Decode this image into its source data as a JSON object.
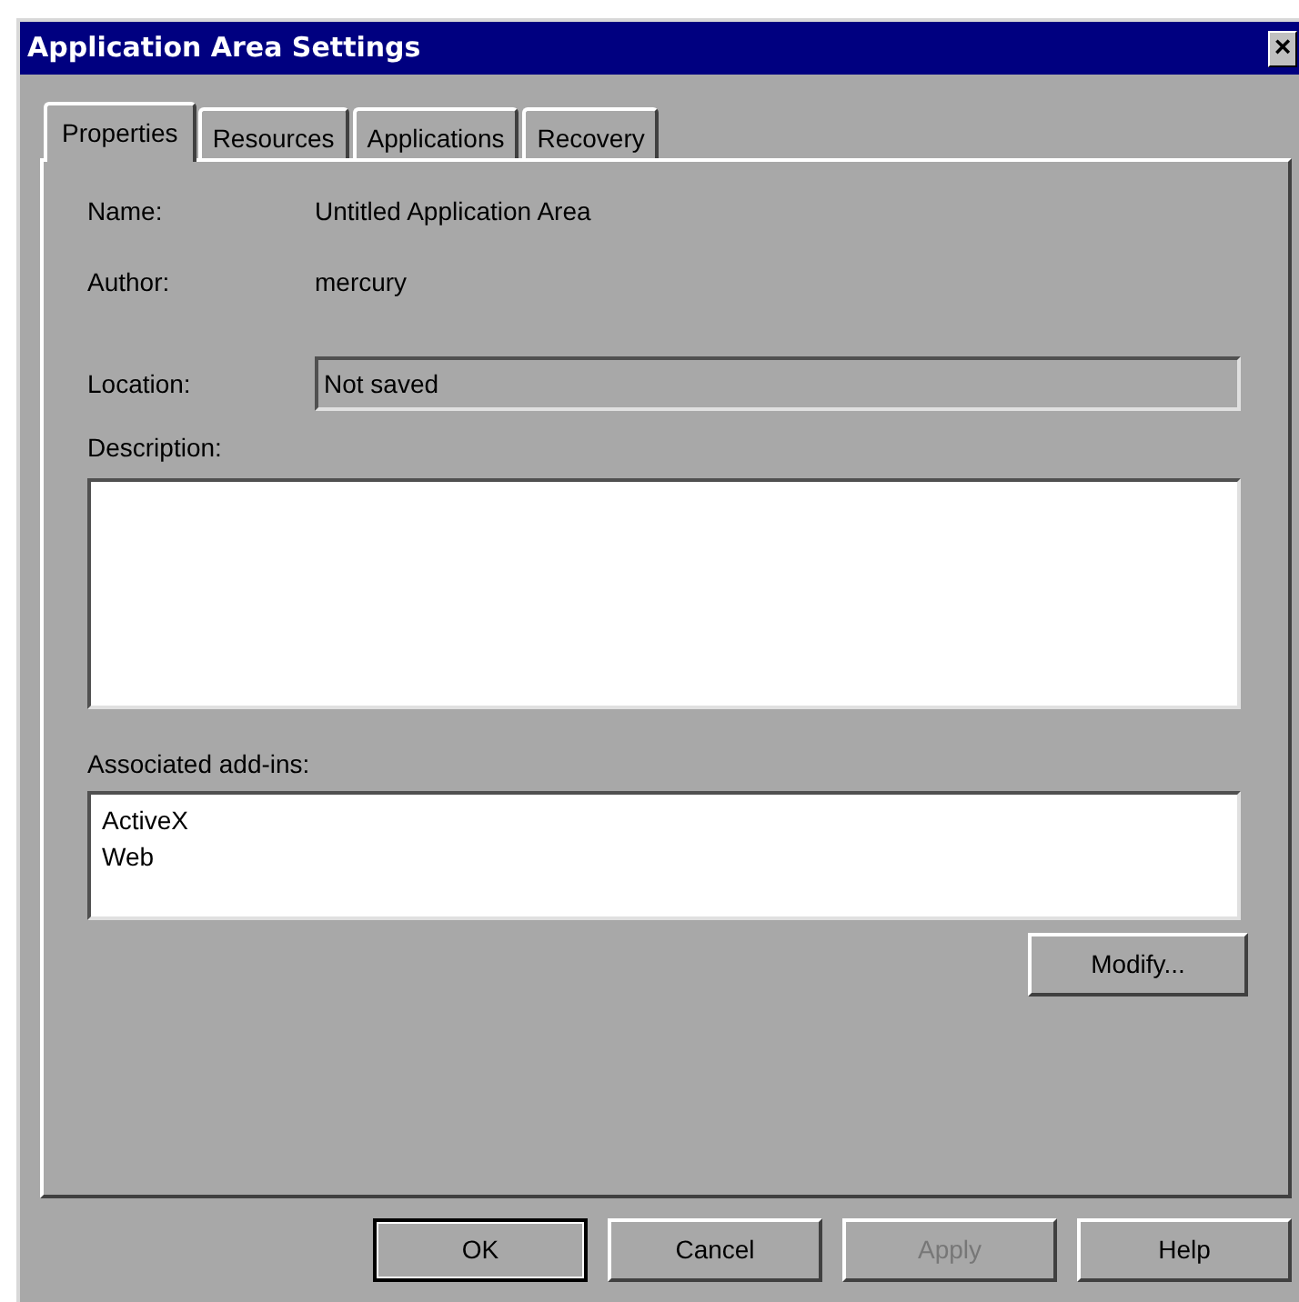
{
  "window": {
    "title": "Application Area Settings",
    "close": "×"
  },
  "tabs": [
    {
      "label": "Properties",
      "selected": true
    },
    {
      "label": "Resources",
      "selected": false
    },
    {
      "label": "Applications",
      "selected": false
    },
    {
      "label": "Recovery",
      "selected": false
    }
  ],
  "properties": {
    "name_label": "Name:",
    "name": "Untitled Application Area",
    "author_label": "Author:",
    "author": "mercury",
    "location_label": "Location:",
    "location": "Not saved",
    "description_label": "Description:",
    "addins_label": "Associated add-ins:",
    "addins": [
      "ActiveX",
      "Web"
    ],
    "modify_button": "Modify..."
  },
  "buttons": [
    {
      "label": "OK",
      "default": true,
      "disabled": false
    },
    {
      "label": "Cancel",
      "default": false,
      "disabled": false
    },
    {
      "label": "Apply",
      "default": false,
      "disabled": true
    },
    {
      "label": "Help",
      "default": false,
      "disabled": false
    }
  ]
}
